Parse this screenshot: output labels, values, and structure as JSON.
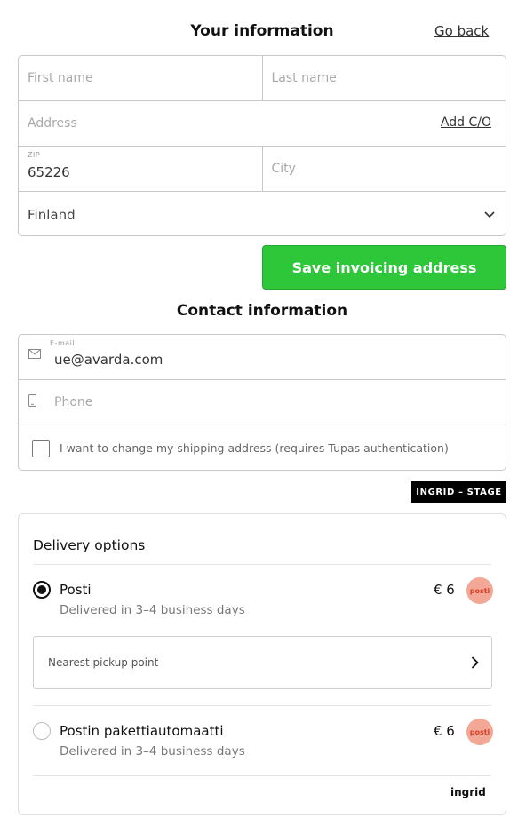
{
  "header": {
    "title": "Your information",
    "go_back": "Go back"
  },
  "address_form": {
    "first_name_placeholder": "First name",
    "last_name_placeholder": "Last name",
    "address_placeholder": "Address",
    "add_co_link": "Add C/O",
    "zip_label": "ZIP",
    "zip_value": "65226",
    "city_placeholder": "City",
    "country_value": "Finland",
    "save_button": "Save invoicing address"
  },
  "contact": {
    "title": "Contact information",
    "email_label": "E-mail",
    "email_value": "ue@avarda.com",
    "phone_placeholder": "Phone",
    "shipping_checkbox_label": "I want to change my shipping address (requires Tupas authentication)"
  },
  "stage_badge": "INGRID – STAGE",
  "delivery": {
    "title": "Delivery options",
    "options": [
      {
        "name": "Posti",
        "subtitle": "Delivered in 3–4 business days",
        "price": "€ 6",
        "logo": "posti",
        "selected": true
      },
      {
        "name": "Postin pakettiautomaatti",
        "subtitle": "Delivered in 3–4 business days",
        "price": "€ 6",
        "logo": "posti",
        "selected": false
      }
    ],
    "pickup_label": "Nearest pickup point",
    "footer_brand": "ingrid"
  },
  "colors": {
    "accent_green": "#2fc73a",
    "posti_badge": "#f3a796"
  }
}
